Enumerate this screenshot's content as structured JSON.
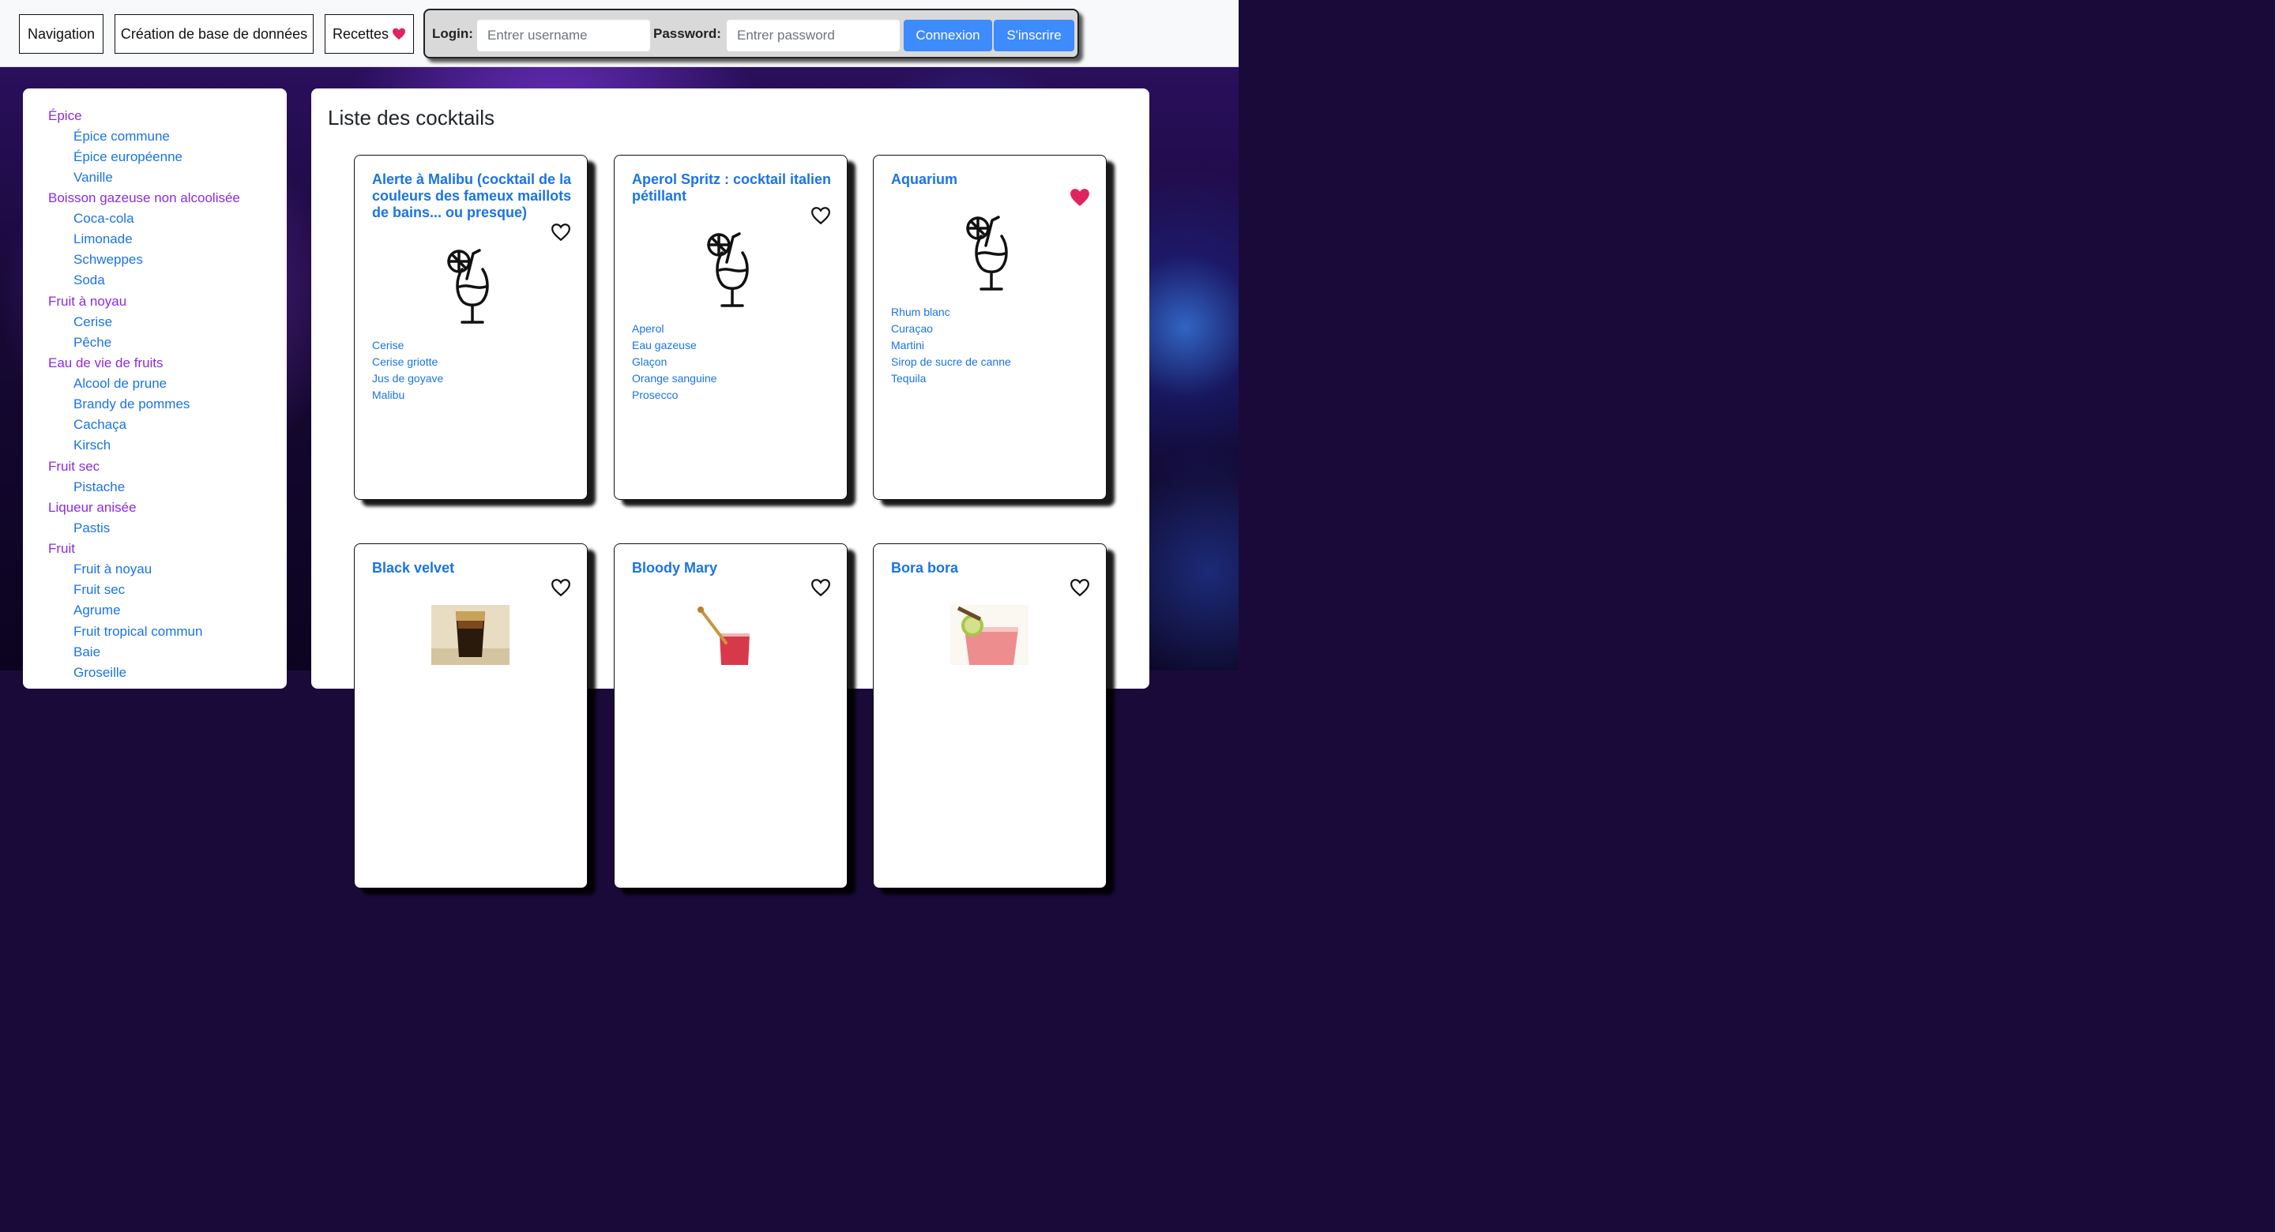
{
  "nav": {
    "navigation": "Navigation",
    "creation": "Création de base de données",
    "recettes": "Recettes",
    "recettes_icon": "heart-icon"
  },
  "login": {
    "login_label": "Login:",
    "username_placeholder": "Entrer username",
    "password_label": "Password:",
    "password_placeholder": "Entrer password",
    "connexion": "Connexion",
    "inscrire": "S'inscrire"
  },
  "sidebar": {
    "items": [
      {
        "label": "Épice",
        "level": 0
      },
      {
        "label": "Épice commune",
        "level": 1
      },
      {
        "label": "Épice européenne",
        "level": 1
      },
      {
        "label": "Vanille",
        "level": 1
      },
      {
        "label": "Boisson gazeuse non alcoolisée",
        "level": 0
      },
      {
        "label": "Coca-cola",
        "level": 1
      },
      {
        "label": "Limonade",
        "level": 1
      },
      {
        "label": "Schweppes",
        "level": 1
      },
      {
        "label": "Soda",
        "level": 1
      },
      {
        "label": "Fruit à noyau",
        "level": 0
      },
      {
        "label": "Cerise",
        "level": 1
      },
      {
        "label": "Pêche",
        "level": 1
      },
      {
        "label": "Eau de vie de fruits",
        "level": 0
      },
      {
        "label": "Alcool de prune",
        "level": 1
      },
      {
        "label": "Brandy de pommes",
        "level": 1
      },
      {
        "label": "Cachaça",
        "level": 1
      },
      {
        "label": "Kirsch",
        "level": 1
      },
      {
        "label": "Fruit sec",
        "level": 0
      },
      {
        "label": "Pistache",
        "level": 1
      },
      {
        "label": "Liqueur anisée",
        "level": 0
      },
      {
        "label": "Pastis",
        "level": 1
      },
      {
        "label": "Fruit",
        "level": 0
      },
      {
        "label": "Fruit à noyau",
        "level": 1
      },
      {
        "label": "Fruit sec",
        "level": 1
      },
      {
        "label": "Agrume",
        "level": 1
      },
      {
        "label": "Fruit tropical commun",
        "level": 1
      },
      {
        "label": "Baie",
        "level": 1
      },
      {
        "label": "Groseille",
        "level": 1
      }
    ]
  },
  "main": {
    "title": "Liste des cocktails",
    "cards": [
      {
        "title": "Alerte à Malibu (cocktail de la couleurs des fameux maillots de bains... ou presque)",
        "favorite": false,
        "image": "cocktail-glass-icon",
        "ingredients": [
          "Cerise",
          "Cerise griotte",
          "Jus de goyave",
          "Malibu"
        ]
      },
      {
        "title": "Aperol Spritz : cocktail italien pétillant",
        "favorite": false,
        "image": "cocktail-glass-icon",
        "ingredients": [
          "Aperol",
          "Eau gazeuse",
          "Glaçon",
          "Orange sanguine",
          "Prosecco"
        ]
      },
      {
        "title": "Aquarium",
        "favorite": true,
        "image": "cocktail-glass-icon",
        "ingredients": [
          "Rhum blanc",
          "Curaçao",
          "Martini",
          "Sirop de sucre de canne",
          "Tequila"
        ]
      },
      {
        "title": "Black velvet",
        "favorite": false,
        "image": "black-velvet-photo",
        "ingredients": []
      },
      {
        "title": "Bloody Mary",
        "favorite": false,
        "image": "bloody-mary-photo",
        "ingredients": []
      },
      {
        "title": "Bora bora",
        "favorite": false,
        "image": "bora-bora-photo",
        "ingredients": []
      }
    ]
  },
  "colors": {
    "accent": "#3d8bfd",
    "link": "#1a73e8",
    "category": "#8a2be2",
    "favorite": "#e0245e"
  }
}
